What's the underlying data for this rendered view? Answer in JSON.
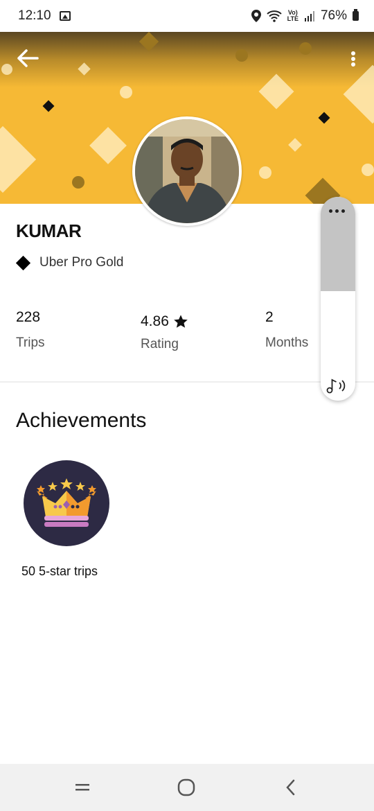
{
  "status_bar": {
    "time": "12:10",
    "volte_top": "Vo)",
    "volte_bottom": "LTE",
    "battery": "76%"
  },
  "header": {
    "back_icon": "arrow-left-icon",
    "menu_icon": "more-vertical-icon",
    "banner_color": "#f6b935"
  },
  "profile": {
    "name": "KUMAR",
    "tier": "Uber Pro Gold"
  },
  "stats": [
    {
      "value": "228",
      "label": "Trips"
    },
    {
      "value": "4.86",
      "label": "Rating",
      "icon": "star-icon"
    },
    {
      "value": "2",
      "label": "Months"
    }
  ],
  "achievements": {
    "title": "Achievements",
    "items": [
      {
        "label": "50 5-star trips",
        "icon": "crown-icon"
      }
    ]
  },
  "media_widget": {
    "menu_icon": "more-horizontal-icon",
    "audio_icon": "music-note-icon"
  },
  "nav": {
    "recents_icon": "recents-icon",
    "home_icon": "home-icon",
    "back_icon": "back-chevron-icon"
  }
}
